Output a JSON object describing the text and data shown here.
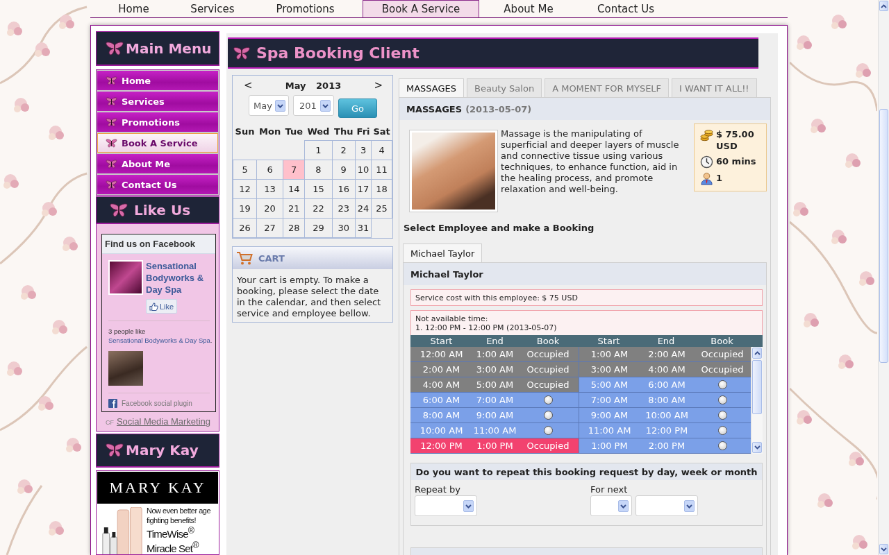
{
  "top_nav": [
    {
      "label": "Home",
      "selected": false
    },
    {
      "label": "Services",
      "selected": false
    },
    {
      "label": "Promotions",
      "selected": false
    },
    {
      "label": "Book A Service",
      "selected": true
    },
    {
      "label": "About Me",
      "selected": false
    },
    {
      "label": "Contact Us",
      "selected": false
    }
  ],
  "sidebar": {
    "main_menu": {
      "title": "Main Menu",
      "items": [
        {
          "label": "Home",
          "selected": false
        },
        {
          "label": "Services",
          "selected": false
        },
        {
          "label": "Promotions",
          "selected": false
        },
        {
          "label": "Book A Service",
          "selected": true
        },
        {
          "label": "About Me",
          "selected": false
        },
        {
          "label": "Contact Us",
          "selected": false
        }
      ]
    },
    "like_us": {
      "title": "Like Us",
      "facebook": {
        "header": "Find us on Facebook",
        "page_name": "Sensational Bodyworks & Day Spa",
        "like_button": "Like",
        "fans_prefix": "3 people like",
        "fans_link": "Sensational Bodyworks & Day Spa",
        "fans_suffix": ".",
        "plugin_label": "Facebook social plugin"
      },
      "credit_prefix": "CF",
      "credit_link": "Social Media Marketing"
    },
    "mary_kay": {
      "title": "Mary Kay",
      "ad": {
        "brand": "MARY KAY",
        "tagline": "Now even better age fighting benefits!",
        "product": "TimeWise$^{®}$ Miracle Set$^{®}$"
      }
    }
  },
  "page_title": "Spa Booking Client",
  "calendar": {
    "prev": "<",
    "title": "May 2013",
    "next": ">",
    "month_select": "May",
    "year_select": "201",
    "go_button": "Go",
    "weekdays": [
      "Sun",
      "Mon",
      "Tue",
      "Wed",
      "Thu",
      "Fri",
      "Sat"
    ],
    "weeks": [
      [
        {
          "kind": "blank"
        },
        {
          "kind": "blank"
        },
        {
          "kind": "blank"
        },
        {
          "kind": "day",
          "day": "1",
          "selected": false
        },
        {
          "kind": "day",
          "day": "2",
          "selected": false
        },
        {
          "kind": "day",
          "day": "3",
          "selected": false
        },
        {
          "kind": "day",
          "day": "4",
          "selected": false
        }
      ],
      [
        {
          "kind": "day",
          "day": "5",
          "selected": false
        },
        {
          "kind": "day",
          "day": "6",
          "selected": false
        },
        {
          "kind": "day",
          "day": "7",
          "selected": true
        },
        {
          "kind": "day",
          "day": "8",
          "selected": false
        },
        {
          "kind": "day",
          "day": "9",
          "selected": false
        },
        {
          "kind": "day",
          "day": "10",
          "selected": false
        },
        {
          "kind": "day",
          "day": "11",
          "selected": false
        }
      ],
      [
        {
          "kind": "day",
          "day": "12",
          "selected": false
        },
        {
          "kind": "day",
          "day": "13",
          "selected": false
        },
        {
          "kind": "day",
          "day": "14",
          "selected": false
        },
        {
          "kind": "day",
          "day": "15",
          "selected": false
        },
        {
          "kind": "day",
          "day": "16",
          "selected": false
        },
        {
          "kind": "day",
          "day": "17",
          "selected": false
        },
        {
          "kind": "day",
          "day": "18",
          "selected": false
        }
      ],
      [
        {
          "kind": "day",
          "day": "19",
          "selected": false
        },
        {
          "kind": "day",
          "day": "20",
          "selected": false
        },
        {
          "kind": "day",
          "day": "21",
          "selected": false
        },
        {
          "kind": "day",
          "day": "22",
          "selected": false
        },
        {
          "kind": "day",
          "day": "23",
          "selected": false
        },
        {
          "kind": "day",
          "day": "24",
          "selected": false
        },
        {
          "kind": "day",
          "day": "25",
          "selected": false
        }
      ],
      [
        {
          "kind": "day",
          "day": "26",
          "selected": false
        },
        {
          "kind": "day",
          "day": "27",
          "selected": false
        },
        {
          "kind": "day",
          "day": "28",
          "selected": false
        },
        {
          "kind": "day",
          "day": "29",
          "selected": false
        },
        {
          "kind": "day",
          "day": "30",
          "selected": false
        },
        {
          "kind": "day",
          "day": "31",
          "selected": false
        },
        {
          "kind": "blank"
        }
      ]
    ]
  },
  "cart": {
    "title": "CART",
    "message": "Your cart is empty. To make a booking, please select the date in the calendar, and then select service and employee bellow."
  },
  "service_tabs": [
    {
      "label": "MASSAGES",
      "selected": true
    },
    {
      "label": "Beauty Salon",
      "selected": false
    },
    {
      "label": "A MOMENT FOR MYSELF",
      "selected": false
    },
    {
      "label": "I WANT IT ALL!!",
      "selected": false
    }
  ],
  "service": {
    "name": "MASSAGES",
    "date": "(2013-05-07)",
    "description": "Massage is the manipulating of superficial and deeper layers of muscle and connective tissue using various techniques, to enhance function, aid in the healing process, and promote relaxation and well-being.",
    "price": "$ 75.00 USD",
    "duration": "60 mins",
    "capacity": "1"
  },
  "employee": {
    "heading": "Select Employee and make a Booking",
    "tabs": [
      {
        "label": "Michael Taylor",
        "selected": true
      }
    ],
    "name": "Michael Taylor",
    "cost_note": "Service cost with this employee: $ 75 USD",
    "unavailable_title": "Not available time:",
    "unavailable_items": [
      "1. 12:00 PM - 12:00 PM (2013-05-07)"
    ],
    "slots": {
      "column_groups": [
        {
          "start": "Start",
          "end": "End",
          "book": "Book"
        },
        {
          "start": "Start",
          "end": "End",
          "book": "Book"
        }
      ],
      "rows": [
        [
          {
            "kind": "occupied",
            "start": "12:00 AM",
            "end": "1:00 AM",
            "book": "Occupied"
          },
          {
            "kind": "occupied",
            "start": "1:00 AM",
            "end": "2:00 AM",
            "book": "Occupied"
          }
        ],
        [
          {
            "kind": "occupied",
            "start": "2:00 AM",
            "end": "3:00 AM",
            "book": "Occupied"
          },
          {
            "kind": "occupied",
            "start": "3:00 AM",
            "end": "4:00 AM",
            "book": "Occupied"
          }
        ],
        [
          {
            "kind": "occupied",
            "start": "4:00 AM",
            "end": "5:00 AM",
            "book": "Occupied"
          },
          {
            "kind": "open",
            "start": "5:00 AM",
            "end": "6:00 AM",
            "selected": false
          }
        ],
        [
          {
            "kind": "open",
            "start": "6:00 AM",
            "end": "7:00 AM",
            "selected": false
          },
          {
            "kind": "open",
            "start": "7:00 AM",
            "end": "8:00 AM",
            "selected": false
          }
        ],
        [
          {
            "kind": "open",
            "start": "8:00 AM",
            "end": "9:00 AM",
            "selected": false
          },
          {
            "kind": "open",
            "start": "9:00 AM",
            "end": "10:00 AM",
            "selected": false
          }
        ],
        [
          {
            "kind": "open",
            "start": "10:00 AM",
            "end": "11:00 AM",
            "selected": false
          },
          {
            "kind": "open",
            "start": "11:00 AM",
            "end": "12:00 PM",
            "selected": false
          }
        ],
        [
          {
            "kind": "blocked",
            "start": "12:00 PM",
            "end": "1:00 PM",
            "book": "Occupied"
          },
          {
            "kind": "open",
            "start": "1:00 PM",
            "end": "2:00 PM",
            "selected": false
          }
        ]
      ]
    }
  },
  "repeat": {
    "title": "Do you want to repeat this booking request by day, week or month",
    "repeat_by_label": "Repeat by",
    "for_next_label": "For next"
  }
}
